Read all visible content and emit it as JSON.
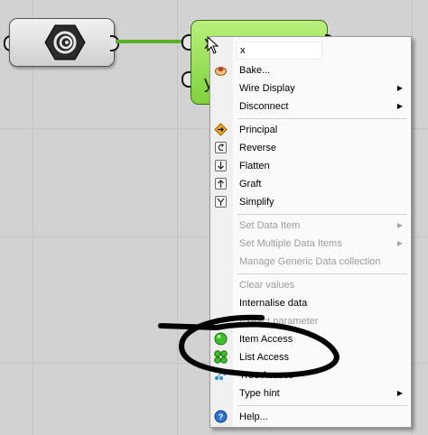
{
  "canvas": {
    "source_component": {
      "icon": "spiral-hexagon-icon"
    },
    "target_component": {
      "inputs": [
        "x",
        "y"
      ]
    }
  },
  "context_menu": {
    "name_field": {
      "value": "x"
    },
    "items": [
      {
        "label": "Bake...",
        "icon": "bake-icon",
        "enabled": true,
        "submenu": false
      },
      {
        "label": "Wire Display",
        "icon": "",
        "enabled": true,
        "submenu": true
      },
      {
        "label": "Disconnect",
        "icon": "",
        "enabled": true,
        "submenu": true
      },
      {
        "label": "Principal",
        "icon": "principal-diamond-icon",
        "enabled": true,
        "submenu": false
      },
      {
        "label": "Reverse",
        "icon": "reverse-icon",
        "enabled": true,
        "submenu": false
      },
      {
        "label": "Flatten",
        "icon": "flatten-icon",
        "enabled": true,
        "submenu": false
      },
      {
        "label": "Graft",
        "icon": "graft-icon",
        "enabled": true,
        "submenu": false
      },
      {
        "label": "Simplify",
        "icon": "simplify-icon",
        "enabled": true,
        "submenu": false
      },
      {
        "label": "Set Data Item",
        "icon": "",
        "enabled": false,
        "submenu": true
      },
      {
        "label": "Set Multiple Data Items",
        "icon": "",
        "enabled": false,
        "submenu": true
      },
      {
        "label": "Manage Generic Data collection",
        "icon": "",
        "enabled": false,
        "submenu": false
      },
      {
        "label": "Clear values",
        "icon": "",
        "enabled": false,
        "submenu": false
      },
      {
        "label": "Internalise data",
        "icon": "",
        "enabled": true,
        "submenu": false
      },
      {
        "label": "Extract parameter",
        "icon": "",
        "enabled": false,
        "submenu": false
      },
      {
        "label": "Item Access",
        "icon": "item-access-green-circle-icon",
        "enabled": true,
        "submenu": false
      },
      {
        "label": "List Access",
        "icon": "list-access-four-circles-icon",
        "enabled": true,
        "submenu": false
      },
      {
        "label": "Tree Access",
        "icon": "tree-access-icon",
        "enabled": true,
        "submenu": false
      },
      {
        "label": "Type hint",
        "icon": "",
        "enabled": true,
        "submenu": true
      },
      {
        "label": "Help...",
        "icon": "help-icon",
        "enabled": true,
        "submenu": false
      }
    ],
    "submenu_arrow": "▶"
  },
  "colors": {
    "canvas_bg": "#d2d2d2",
    "component_green": "#8edb4a",
    "wire_green": "#5ab02b",
    "annotation_ink": "#000000",
    "disabled_text": "#9c9c9c"
  }
}
